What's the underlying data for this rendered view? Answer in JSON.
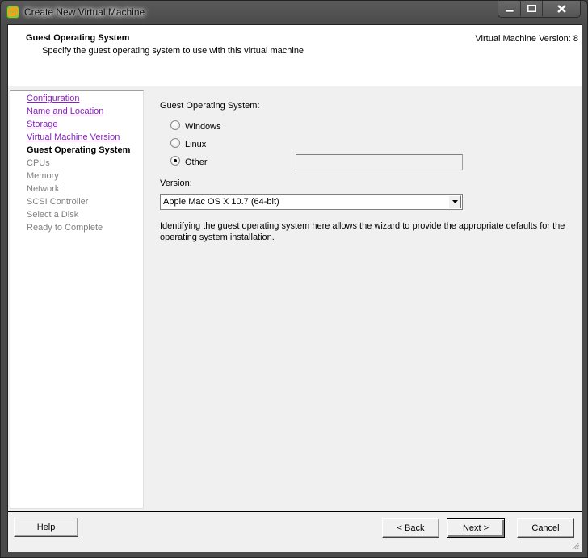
{
  "window": {
    "title": "Create New Virtual Machine",
    "app_icon": "vsphere-app-icon",
    "caption_buttons": [
      "minimize",
      "maximize",
      "close"
    ]
  },
  "header": {
    "title": "Guest Operating System",
    "subtitle": "Specify the guest operating system to use with this virtual machine",
    "version_label": "Virtual Machine Version: 8"
  },
  "sidebar": {
    "items": [
      {
        "label": "Configuration",
        "state": "done"
      },
      {
        "label": "Name and Location",
        "state": "done"
      },
      {
        "label": "Storage",
        "state": "done"
      },
      {
        "label": "Virtual Machine Version",
        "state": "done"
      },
      {
        "label": "Guest Operating System",
        "state": "current"
      },
      {
        "label": "CPUs",
        "state": "future"
      },
      {
        "label": "Memory",
        "state": "future"
      },
      {
        "label": "Network",
        "state": "future"
      },
      {
        "label": "SCSI Controller",
        "state": "future"
      },
      {
        "label": "Select a Disk",
        "state": "future"
      },
      {
        "label": "Ready to Complete",
        "state": "future"
      }
    ]
  },
  "main": {
    "guest_os_label": "Guest Operating System:",
    "os_options": [
      {
        "label": "Windows",
        "selected": false
      },
      {
        "label": "Linux",
        "selected": false
      },
      {
        "label": "Other",
        "selected": true
      }
    ],
    "other_input_value": "",
    "version_label": "Version:",
    "version_selected": "Apple Mac OS X 10.7 (64-bit)",
    "description": "Identifying the guest operating system here allows the wizard to provide the appropriate defaults for the operating system installation."
  },
  "footer": {
    "help_label": "Help",
    "back_label": "< Back",
    "next_label": "Next >",
    "cancel_label": "Cancel"
  }
}
